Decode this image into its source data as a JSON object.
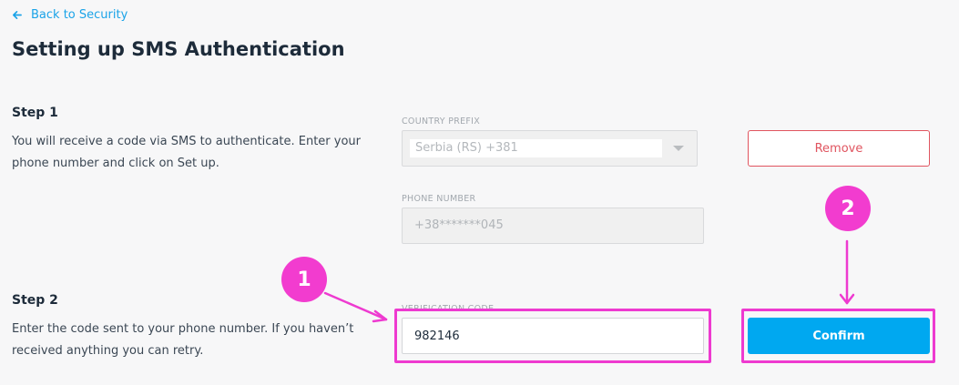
{
  "nav": {
    "back_label": "Back to Security"
  },
  "page": {
    "title": "Setting up SMS Authentication"
  },
  "step1": {
    "title": "Step 1",
    "description": "You will receive a code via SMS to authenticate. Enter your phone number and click on Set up."
  },
  "step2": {
    "title": "Step 2",
    "description": "Enter the code sent to your phone number. If you haven’t received anything you can retry."
  },
  "fields": {
    "country_prefix_label": "COUNTRY PREFIX",
    "country_prefix_value": "Serbia (RS) +381",
    "phone_number_label": "PHONE NUMBER",
    "phone_number_value": "+38*******045",
    "verification_code_label": "VERIFICATION CODE",
    "verification_code_value": "982146"
  },
  "buttons": {
    "remove_label": "Remove",
    "confirm_label": "Confirm"
  },
  "annotations": {
    "badge_1": "1",
    "badge_2": "2"
  },
  "colors": {
    "accent": "#00a8f0",
    "danger": "#e0545f",
    "highlight": "#ee3ad0",
    "link": "#1aa3e8"
  },
  "icons": {
    "back": "arrow-left-icon",
    "select_caret": "caret-down-icon"
  }
}
